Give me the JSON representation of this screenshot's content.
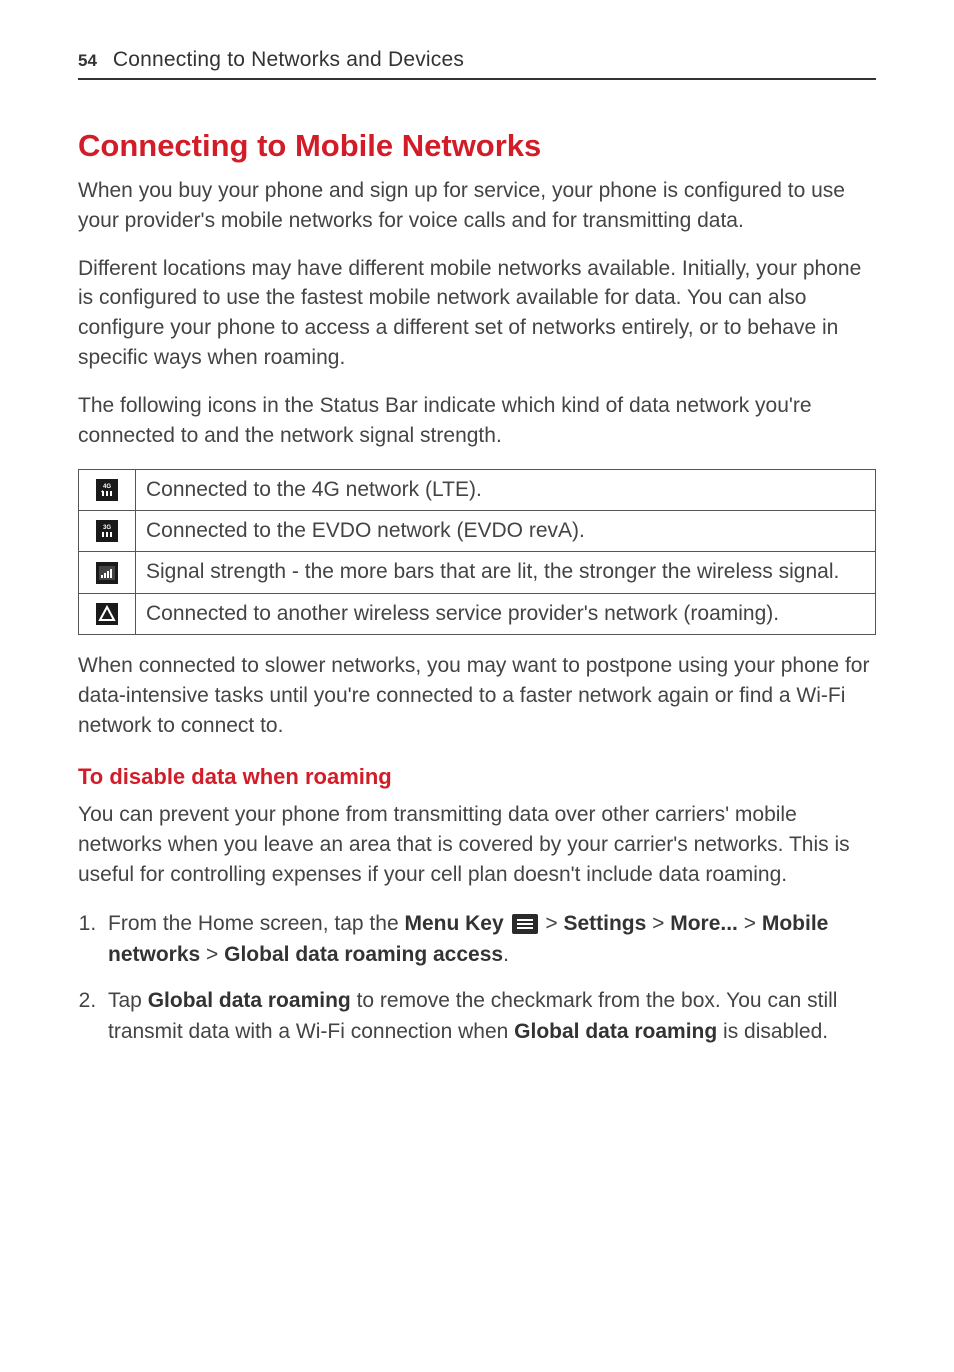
{
  "page_number": "54",
  "chapter": "Connecting to Networks and Devices",
  "section_title": "Connecting to Mobile Networks",
  "intro_para_1": "When you buy your phone and sign up for service, your phone is configured to use your provider's mobile networks for voice calls and for transmitting data.",
  "intro_para_2": "Different locations may have different mobile networks available. Initially, your phone is configured to use the fastest mobile network available for data. You can also configure your phone to access a different set of networks entirely, or to behave in specific ways when roaming.",
  "intro_para_3": "The following icons in the Status Bar indicate which kind of data network you're connected to and the network signal strength.",
  "icon_rows": [
    {
      "icon": "4g-lte-icon",
      "desc": "Connected to the 4G network (LTE)."
    },
    {
      "icon": "3g-evdo-icon",
      "desc": "Connected to the EVDO network (EVDO revA)."
    },
    {
      "icon": "signal-bars-icon",
      "desc": "Signal strength - the more bars that are lit, the stronger the wireless signal."
    },
    {
      "icon": "roaming-icon",
      "desc": "Connected to another wireless service provider's network (roaming)."
    }
  ],
  "after_table_para": "When connected to slower networks, you may want to postpone using your phone for data-intensive tasks until you're connected to a faster network again or find a Wi-Fi network to connect to.",
  "subheading": "To disable data when roaming",
  "subheading_para": "You can prevent your phone from transmitting data over other carriers' mobile networks when you leave an area that is covered by your carrier's networks. This is useful for controlling expenses if your cell plan doesn't include data roaming.",
  "step1": {
    "prefix": "From the Home screen, tap the ",
    "menu_key": "Menu Key",
    "gt1": " > ",
    "settings": "Settings",
    "gt2": " > ",
    "more": "More...",
    "gt3": " > ",
    "mobile_networks": "Mobile networks",
    "gt4": " > ",
    "global_access": "Global data roaming access",
    "period": "."
  },
  "step2": {
    "prefix": "Tap ",
    "gdr1": "Global data roaming",
    "mid1": " to remove the checkmark from the box. You can still transmit data with a Wi-Fi connection when ",
    "gdr2": "Global data roaming",
    "suffix": " is disabled."
  }
}
